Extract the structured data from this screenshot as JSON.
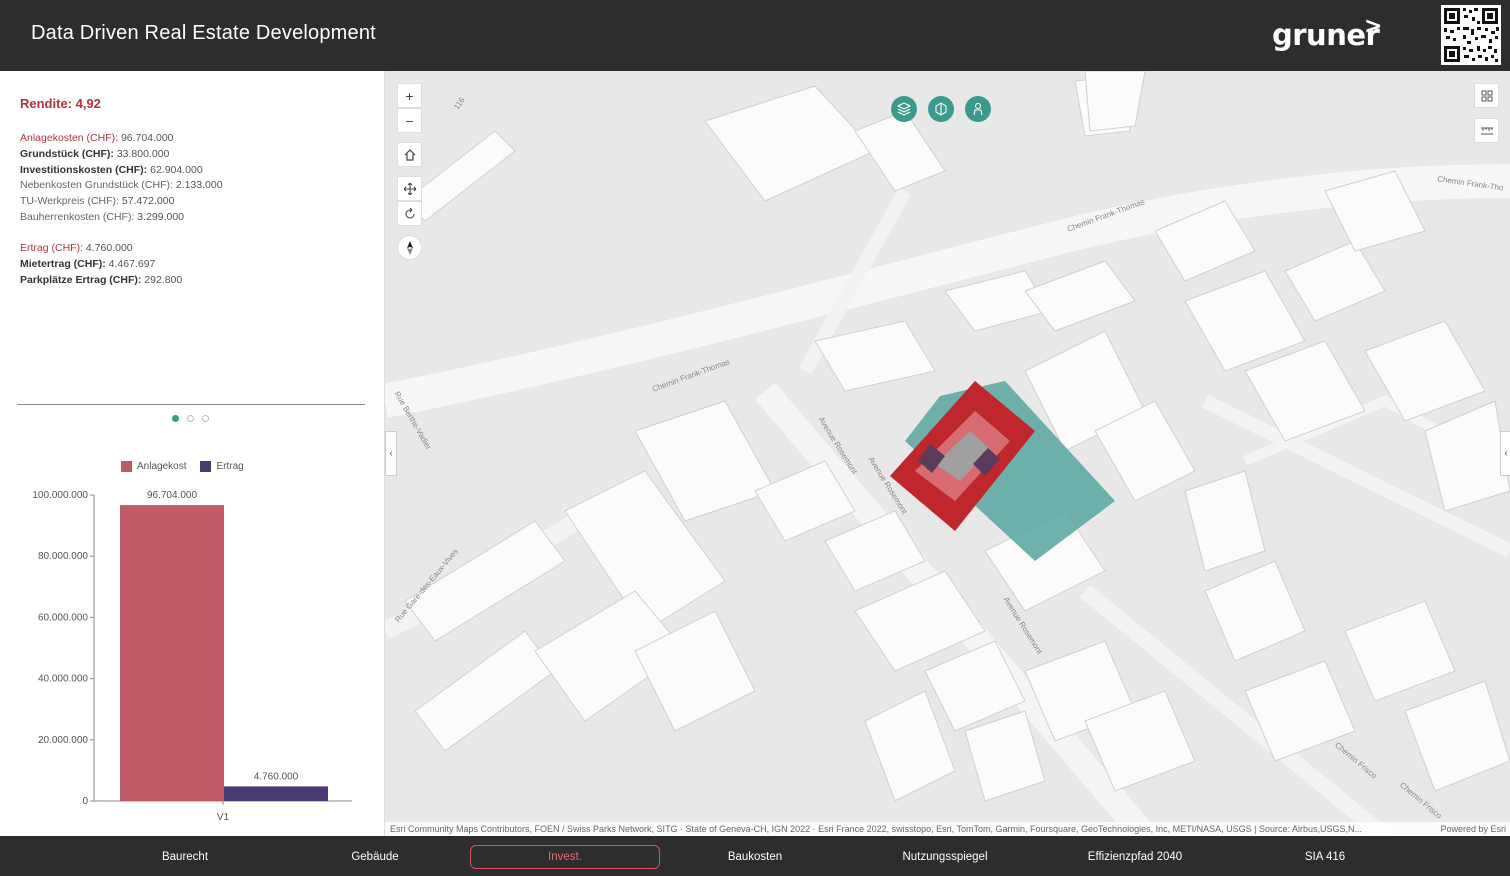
{
  "header": {
    "title": "Data Driven Real Estate Development",
    "logo_text": "gruner",
    "logo_mark": ">"
  },
  "summary": {
    "rendite": "Rendite: 4,92",
    "rows": [
      {
        "key": "Anlagekosten (CHF):",
        "value": " 96.704.000",
        "style": "red"
      },
      {
        "key": "Grundstück (CHF):",
        "value": " 33.800.000",
        "style": "bold"
      },
      {
        "key": "Investitionskosten (CHF):",
        "value": " 62.904.000",
        "style": "bold"
      },
      {
        "key": "Nebenkosten Grundstück (CHF):",
        "value": " 2.133.000",
        "style": "grey"
      },
      {
        "key": "TU-Werkpreis (CHF):",
        "value": " 57.472.000",
        "style": "grey"
      },
      {
        "key": "Bauherrenkosten (CHF):",
        "value": " 3.299.000",
        "style": "grey"
      },
      {
        "key": "Ertrag (CHF):",
        "value": " 4.760.000",
        "style": "red"
      },
      {
        "key": "Mietertrag (CHF):",
        "value": " 4.467.697",
        "style": "bold"
      },
      {
        "key": "Parkplätze Ertrag (CHF):",
        "value": " 292.800",
        "style": "bold"
      }
    ]
  },
  "carousel": {
    "active_index": 0,
    "count": 3
  },
  "chart_data": {
    "type": "bar",
    "categories": [
      "V1"
    ],
    "series": [
      {
        "name": "Anlagekost",
        "values": [
          96704000
        ],
        "color": "#bf5b66",
        "label": "96.704.000"
      },
      {
        "name": "Ertrag",
        "values": [
          4760000
        ],
        "color": "#4b3a72",
        "label": "4.760.000"
      }
    ],
    "ylim": [
      0,
      100000000
    ],
    "yticks": [
      0,
      20000000,
      40000000,
      60000000,
      80000000,
      100000000
    ],
    "ytick_labels": [
      "0",
      "20.000.000",
      "40.000.000",
      "60.000.000",
      "80.000.000",
      "100.000.000"
    ],
    "legend_placement": "top"
  },
  "map": {
    "controls": {
      "zoom_in": "+",
      "zoom_out": "−",
      "home_icon": "home-icon",
      "pan_icon": "pan-icon",
      "rotate_icon": "rotate-icon",
      "compass_icon": "compass-icon"
    },
    "street_labels": [
      "Chemin Frank-Thomas",
      "Chemin Frank-Thomas",
      "Chemin Frank-Tho",
      "Avenue Rosemont",
      "Avenue Rosemont",
      "Avenue Rosemont",
      "Rue Berthe-Vadier",
      "Rue Gare-des-Eaux-Vives",
      "Chemin Frisco",
      "Chemin Frisco",
      "116"
    ],
    "attribution": "Esri Community Maps Contributors, FOEN / Swiss Parks Network, SITG · State of Geneva-CH, IGN 2022 · Esri France 2022, swisstopo, Esri, TomTom, Garmin, Foursquare, GeoTechnologies, Inc, METI/NASA, USGS | Source: Airbus,USGS,N...",
    "powered_by": "Powered by Esri",
    "colors": {
      "site": "#5fa8a4",
      "building": "#c0272d"
    }
  },
  "nav": {
    "items": [
      "Baurecht",
      "Gebäude",
      "Invest.",
      "Baukosten",
      "Nutzungsspiegel",
      "Effizienzpfad 2040",
      "SIA 416"
    ],
    "active": "Invest."
  }
}
